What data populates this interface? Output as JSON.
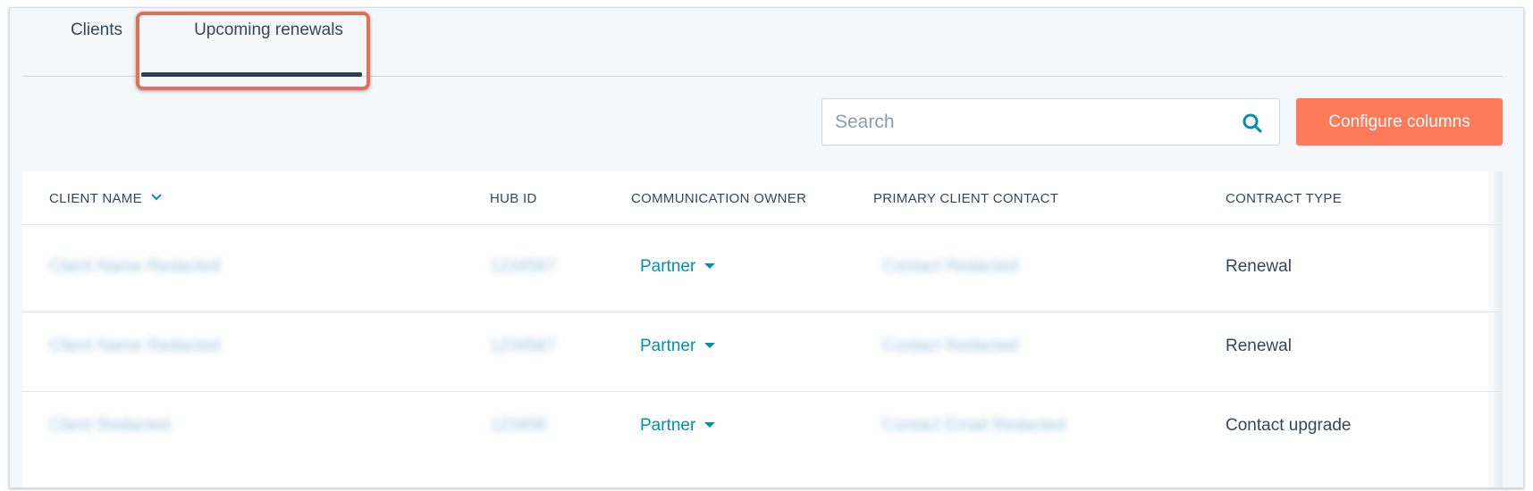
{
  "tabs": [
    {
      "label": "Clients"
    },
    {
      "label": "Upcoming renewals"
    }
  ],
  "toolbar": {
    "search_placeholder": "Search",
    "configure_label": "Configure columns"
  },
  "table": {
    "columns": [
      "CLIENT NAME",
      "HUB ID",
      "COMMUNICATION OWNER",
      "PRIMARY CLIENT CONTACT",
      "CONTRACT TYPE"
    ],
    "rows": [
      {
        "client_name": "Client Name Redacted",
        "hub_id": "1234567",
        "owner": "Partner",
        "contact": "Contact Redacted",
        "contract_type": "Renewal"
      },
      {
        "client_name": "Client Name Redacted",
        "hub_id": "1234567",
        "owner": "Partner",
        "contact": "Contact Redacted",
        "contract_type": "Renewal"
      },
      {
        "client_name": "Client Redacted",
        "hub_id": "123456",
        "owner": "Partner",
        "contact": "Contact Email Redacted",
        "contract_type": "Contact upgrade"
      }
    ]
  },
  "colors": {
    "accent": "#ff7a59",
    "link": "#0091ae",
    "highlight": "#e0705a"
  },
  "icons": {
    "search": "search-icon",
    "sort": "chevron-down-icon",
    "owner_dropdown": "caret-down-icon"
  }
}
